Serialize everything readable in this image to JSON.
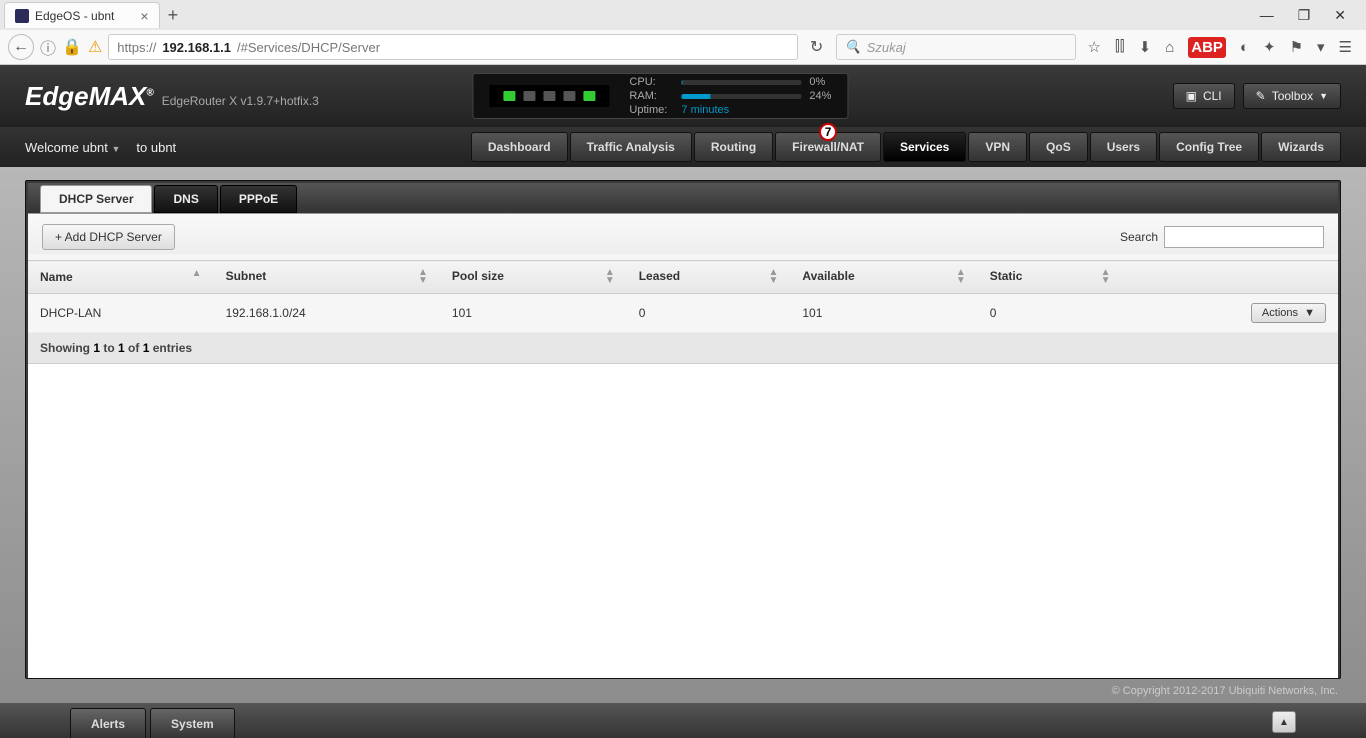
{
  "browser": {
    "tab_title": "EdgeOS - ubnt",
    "url_prefix": "https://",
    "url_host": "192.168.1.1",
    "url_path": "/#Services/DHCP/Server",
    "search_placeholder": "Szukaj"
  },
  "header": {
    "logo_text": "EdgeMAX",
    "model": "EdgeRouter X v1.9.7+hotfix.3",
    "ports": [
      true,
      false,
      false,
      false,
      true
    ],
    "stats": {
      "cpu_label": "CPU:",
      "cpu_pct": "0%",
      "cpu_fill": 1,
      "ram_label": "RAM:",
      "ram_pct": "24%",
      "ram_fill": 24,
      "uptime_label": "Uptime:",
      "uptime_val": "7 minutes"
    },
    "cli_btn": "CLI",
    "toolbox_btn": "Toolbox"
  },
  "welcome": {
    "welcome_text": "Welcome ubnt",
    "to_text": "to ubnt"
  },
  "nav": {
    "items": [
      "Dashboard",
      "Traffic Analysis",
      "Routing",
      "Firewall/NAT",
      "Services",
      "VPN",
      "QoS",
      "Users",
      "Config Tree",
      "Wizards"
    ],
    "active": "Services",
    "badge_on": "Firewall/NAT",
    "badge_val": "7"
  },
  "subtabs": {
    "items": [
      "DHCP Server",
      "DNS",
      "PPPoE"
    ],
    "active": "DHCP Server"
  },
  "panel": {
    "add_btn": "+  Add DHCP Server",
    "search_label": "Search",
    "columns": [
      "Name",
      "Subnet",
      "Pool size",
      "Leased",
      "Available",
      "Static",
      ""
    ],
    "rows": [
      {
        "name": "DHCP-LAN",
        "subnet": "192.168.1.0/24",
        "pool": "101",
        "leased": "0",
        "available": "101",
        "static": "0",
        "actions": "Actions"
      }
    ],
    "info_prefix": "Showing ",
    "info_a": "1",
    "info_mid1": " to ",
    "info_b": "1",
    "info_mid2": " of ",
    "info_c": "1",
    "info_suffix": " entries"
  },
  "footer": {
    "copyright": "© Copyright 2012-2017 Ubiquiti Networks, Inc.",
    "alerts": "Alerts",
    "system": "System"
  }
}
